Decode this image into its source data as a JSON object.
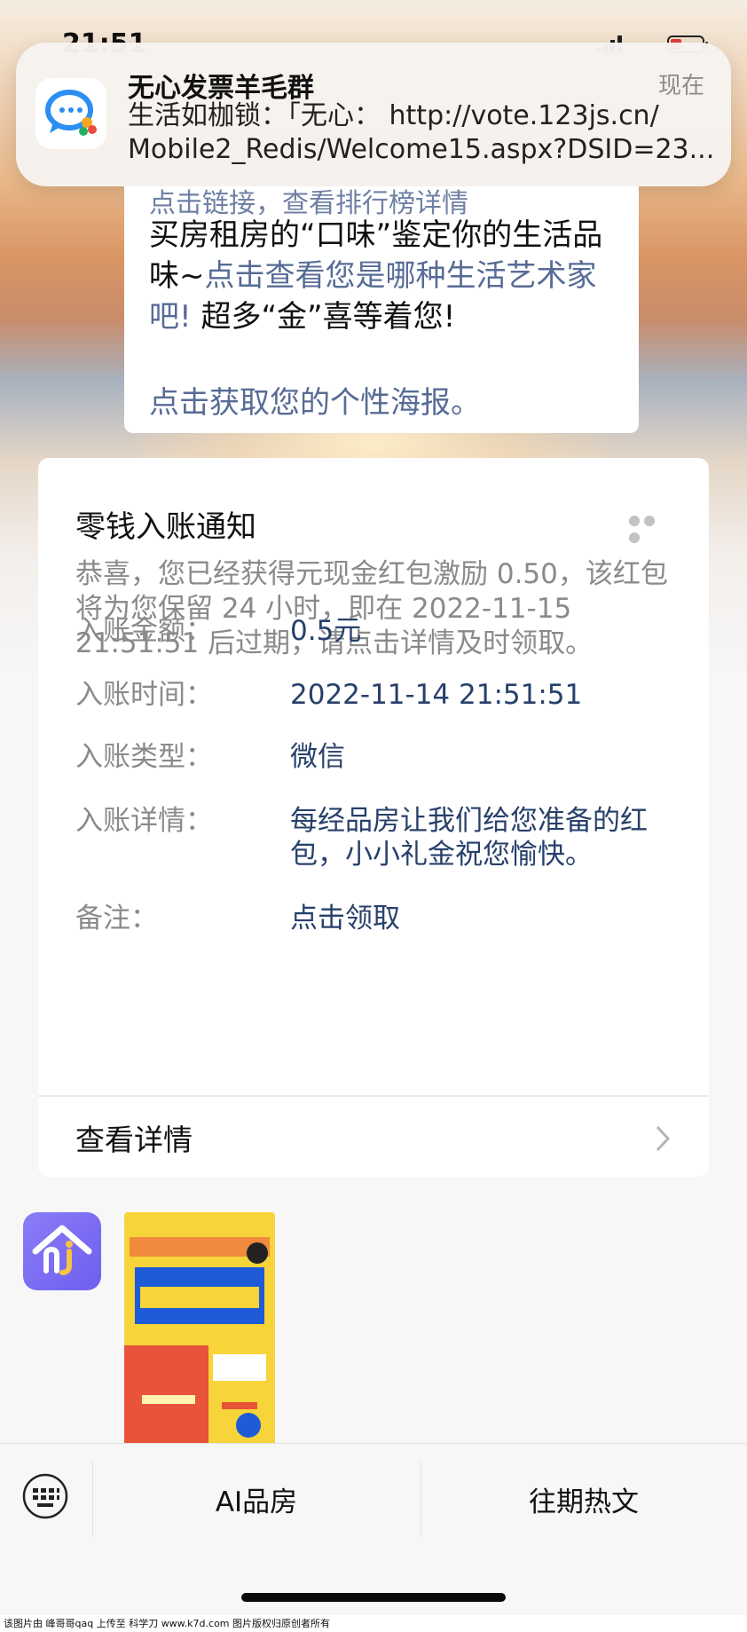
{
  "status_bar": {
    "time": "21:51"
  },
  "notification": {
    "title": "无心发票羊毛群",
    "time": "现在",
    "body_line1": "生活如枷锁：「无心：  http://vote.123js.cn/",
    "body_line2": "Mobile2_Redis/Welcome15.aspx?DSID=23..."
  },
  "article": {
    "partial_top": "点击链接，查看排行榜详情",
    "para_plain1": "买房租房的“口味”鉴定你的生活品味~",
    "para_link": "点击查看您是哪种生活艺术家吧!",
    "para_plain2": " 超多“金”喜等着您!",
    "poster_link": "点击获取您的个性海报。"
  },
  "card": {
    "title": "零钱入账通知",
    "desc": "恭喜，您已经获得元现金红包激励 0.50，该红包将为您保留 24 小时，即在 2022-11-15 21:51:51 后过期，请点击详情及时领取。",
    "rows": [
      {
        "key": "入账金额：",
        "value": "0.5元"
      },
      {
        "key": "入账时间：",
        "value": "2022-11-14 21:51:51"
      },
      {
        "key": "入账类型：",
        "value": "微信"
      },
      {
        "key": "入账详情：",
        "value": "每经品房让我们给您准备的红包，小小礼金祝您愉快。"
      },
      {
        "key": "备注：",
        "value": "点击领取"
      }
    ],
    "detail_label": "查看详情"
  },
  "bottom_menu": {
    "items": [
      "AI品房",
      "往期热文"
    ]
  },
  "footer_text": "该图片由 峰哥哥qaq 上传至 科学刀 www.k7d.com 图片版权归原创者所有",
  "colors": {
    "link": "#576b95",
    "value_text": "#27406b",
    "label_text": "#8a8a8a"
  },
  "icons": {
    "app": "chat-bubble-icon",
    "more": "more-dots-icon",
    "chevron": "chevron-right-icon",
    "keyboard": "keyboard-icon"
  }
}
